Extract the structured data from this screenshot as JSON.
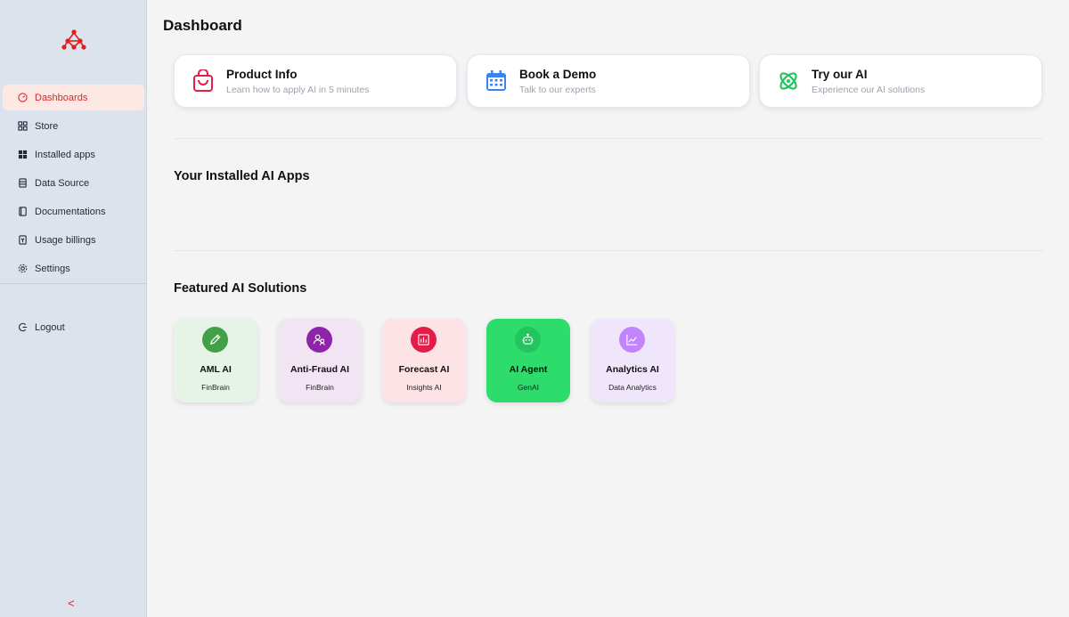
{
  "sidebar": {
    "items": [
      {
        "label": "Dashboards",
        "icon": "gauge-icon",
        "active": true
      },
      {
        "label": "Store",
        "icon": "grid-icon"
      },
      {
        "label": "Installed apps",
        "icon": "apps-icon"
      },
      {
        "label": "Data Source",
        "icon": "database-icon"
      },
      {
        "label": "Documentations",
        "icon": "book-icon"
      },
      {
        "label": "Usage billings",
        "icon": "receipt-icon"
      },
      {
        "label": "Settings",
        "icon": "gear-icon"
      }
    ],
    "logout_label": "Logout",
    "collapse_glyph": "<"
  },
  "main": {
    "title": "Dashboard",
    "quick_links": [
      {
        "title": "Product Info",
        "subtitle": "Learn how to apply AI in 5 minutes",
        "icon": "shopping-bag-icon",
        "color": "#e11d48"
      },
      {
        "title": "Book a Demo",
        "subtitle": "Talk to our experts",
        "icon": "calendar-icon",
        "color": "#3b82f6"
      },
      {
        "title": "Try our AI",
        "subtitle": "Experience our AI solutions",
        "icon": "atom-icon",
        "color": "#22c55e"
      }
    ],
    "installed_title": "Your Installed AI Apps",
    "featured_title": "Featured AI Solutions",
    "featured": [
      {
        "name": "AML AI",
        "category": "FinBrain",
        "icon": "pencil-icon",
        "bg": "#e6f4e8",
        "icon_bg": "#43a047"
      },
      {
        "name": "Anti-Fraud AI",
        "category": "FinBrain",
        "icon": "users-icon",
        "bg": "#f1e4f3",
        "icon_bg": "#8e24aa"
      },
      {
        "name": "Forecast AI",
        "category": "Insights AI",
        "icon": "bar-chart-icon",
        "bg": "#fde3e5",
        "icon_bg": "#e11d48"
      },
      {
        "name": "AI Agent",
        "category": "GenAI",
        "icon": "robot-icon",
        "bg": "#2ddc6b",
        "icon_bg": "#22c55e"
      },
      {
        "name": "Analytics AI",
        "category": "Data Analytics",
        "icon": "trend-chart-icon",
        "bg": "#f0e6fb",
        "icon_bg": "#c084fc"
      }
    ]
  },
  "colors": {
    "accent": "#dc2626",
    "sidebar_bg": "#dde3ec",
    "page_bg": "#f4f4f5"
  }
}
